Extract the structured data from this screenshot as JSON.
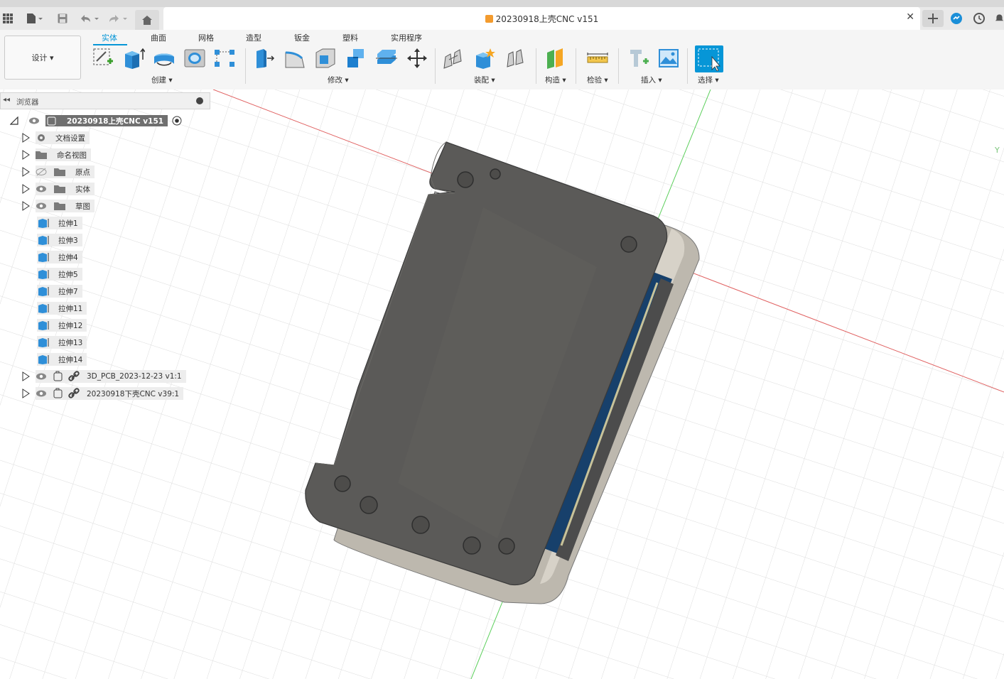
{
  "window": {
    "document_title": "20230918上壳CNC v151"
  },
  "ribbon": {
    "workspace_label": "设计 ▾",
    "tabs": [
      "实体",
      "曲面",
      "网格",
      "造型",
      "钣金",
      "塑料",
      "实用程序"
    ],
    "active_tab": "实体",
    "groups": [
      "创建 ▾",
      "修改 ▾",
      "装配 ▾",
      "构造 ▾",
      "检验 ▾",
      "插入 ▾",
      "选择 ▾"
    ]
  },
  "browser": {
    "title": "浏览器",
    "root": "20230918上壳CNC v151",
    "items": [
      "文档设置",
      "命名视图",
      "原点",
      "实体",
      "草图"
    ],
    "features": [
      "拉伸1",
      "拉伸3",
      "拉伸4",
      "拉伸5",
      "拉伸7",
      "拉伸11",
      "拉伸12",
      "拉伸13",
      "拉伸14"
    ],
    "components": [
      "3D_PCB_2023-12-23 v1:1",
      "20230918下壳CNC v39:1"
    ]
  },
  "colors": {
    "accent": "#0696d7",
    "part_body": "#5b5a58",
    "pcb": "#17406b",
    "pin": "#c9a24a"
  }
}
